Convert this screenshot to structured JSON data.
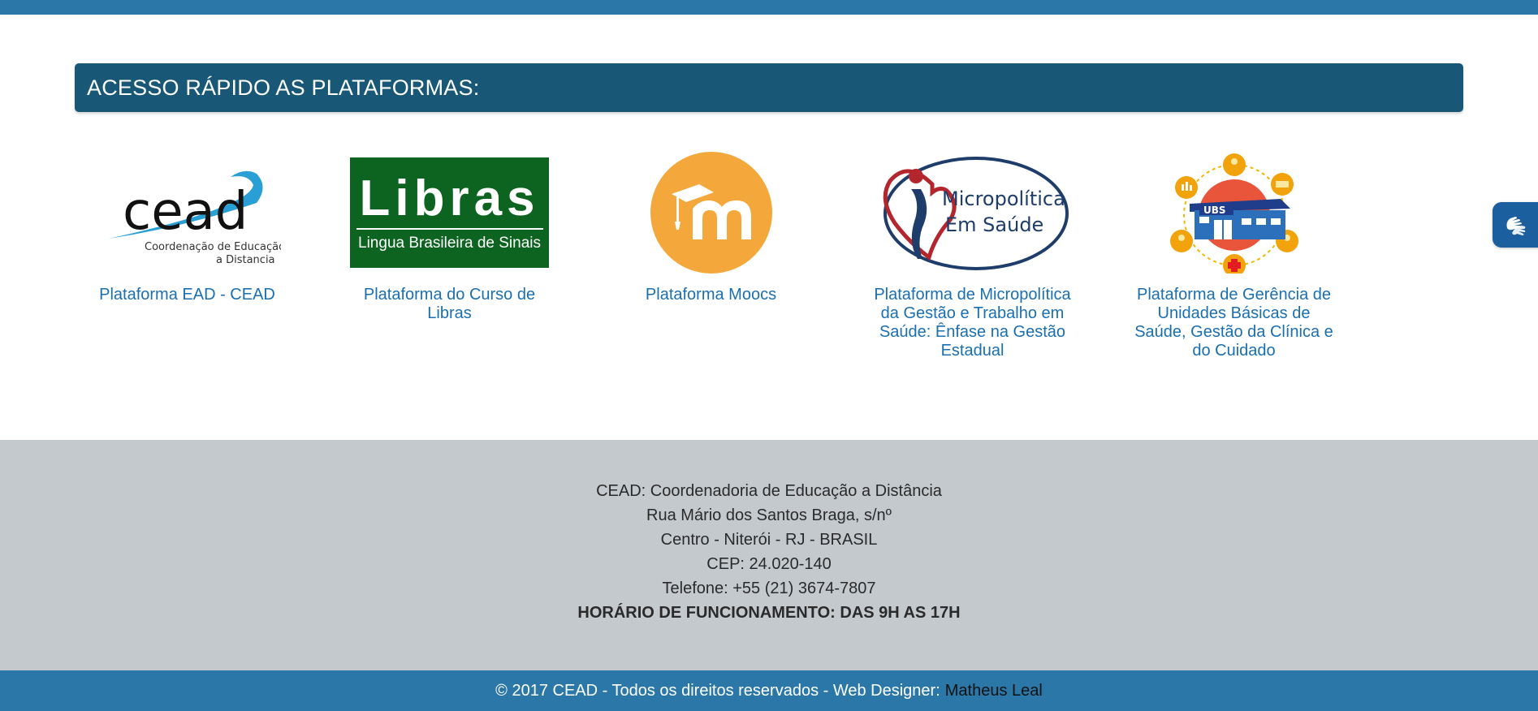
{
  "section": {
    "title": "ACESSO RÁPIDO AS PLATAFORMAS:"
  },
  "colors": {
    "header_bar": "#185876",
    "top_bar": "#2b78a8",
    "footer_bg": "#c4c9ce",
    "copyright_bg": "#2b78a8",
    "link": "#1a6fb0",
    "moodle_orange": "#f4a83b",
    "libras_green": "#0d6421"
  },
  "platforms": [
    {
      "label": "Plataforma EAD - CEAD",
      "logo": {
        "wordmark": "cead",
        "sub1": "Coordenação de Educação",
        "sub2": "a Distancia"
      }
    },
    {
      "label": "Plataforma do Curso de Libras",
      "logo": {
        "title": "Libras",
        "subtitle": "Lingua Brasileira de Sinais"
      }
    },
    {
      "label": "Plataforma Moocs",
      "logo": {
        "icon": "moodle-icon"
      }
    },
    {
      "label": "Plataforma de Micropolítica da Gestão e Trabalho em Saúde: Ênfase na Gestão Estadual",
      "logo": {
        "line1": "Micropolítica",
        "line2": "Em Saúde"
      }
    },
    {
      "label": "Plataforma de Gerência de Unidades Básicas de Saúde, Gestão da Clínica e do Cuidado",
      "logo": {
        "sign": "UBS"
      }
    }
  ],
  "accessibility": {
    "icon": "sign-language-hands-icon"
  },
  "footer": {
    "org": "CEAD: Coordenadoria de Educação a Distância",
    "street": "Rua Mário dos Santos Braga, s/nº",
    "city": "Centro - Niterói - RJ - BRASIL",
    "cep": "CEP: 24.020-140",
    "phone": "Telefone: +55 (21) 3674-7807",
    "hours": "HORÁRIO DE FUNCIONAMENTO: DAS 9H AS 17H"
  },
  "copyright": {
    "text": "© 2017 CEAD - Todos os direitos reservados - Web Designer:",
    "designer": "Matheus Leal"
  }
}
